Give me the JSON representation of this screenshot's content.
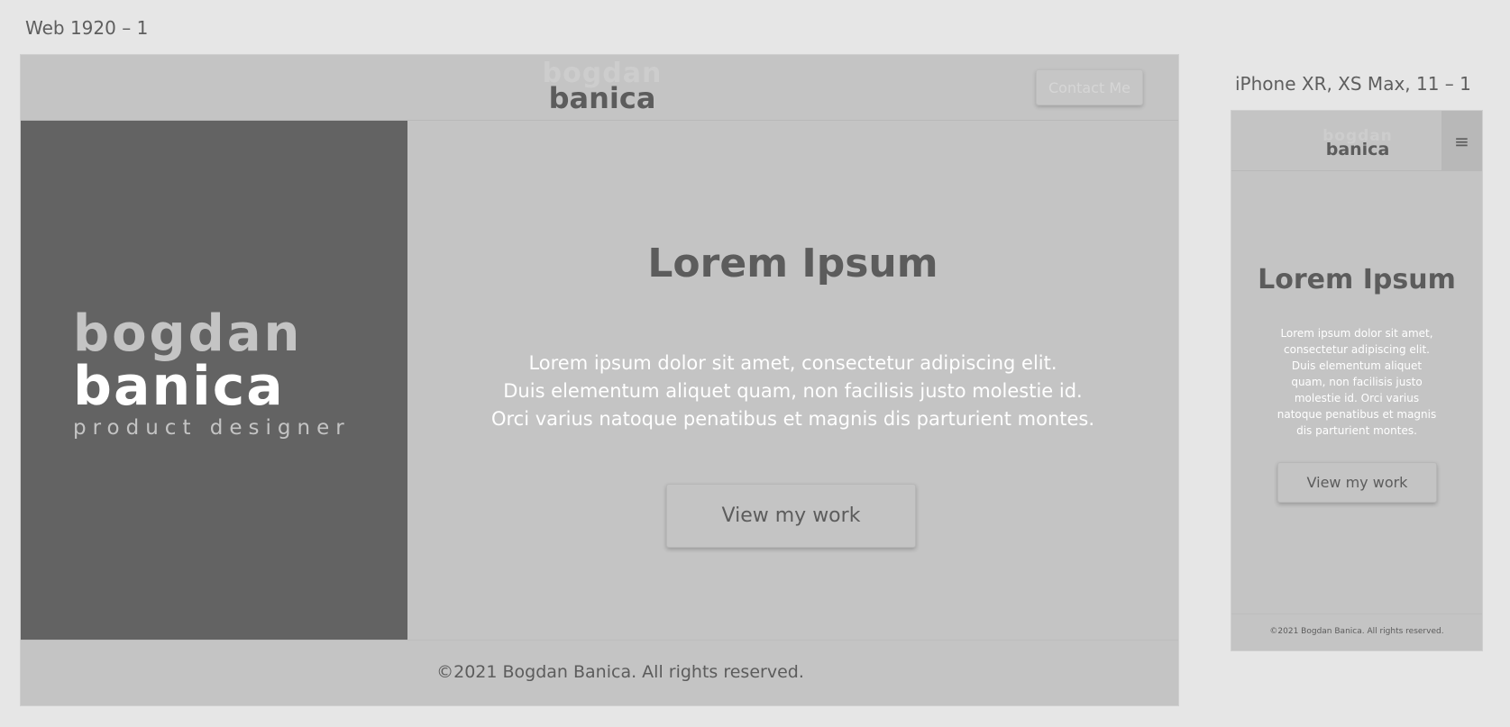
{
  "artboards": {
    "web_label": "Web 1920 – 1",
    "phone_label": "iPhone XR, XS Max, 11 – 1"
  },
  "logo": {
    "line1": "bogdan",
    "line2": "banica"
  },
  "brand": {
    "line1": "bogdan",
    "line2": "banica",
    "tagline": "product designer"
  },
  "header": {
    "contact_label": "Contact Me",
    "menu_icon": "hamburger-icon"
  },
  "hero": {
    "title": "Lorem Ipsum",
    "desktop_lines": [
      "Lorem ipsum dolor sit amet, consectetur adipiscing elit.",
      "Duis elementum aliquet quam, non facilisis justo molestie id.",
      "Orci varius natoque penatibus et magnis dis parturient montes."
    ],
    "mobile_lines": [
      "Lorem ipsum dolor sit amet,",
      "consectetur adipiscing elit.",
      "Duis elementum aliquet",
      "quam, non facilisis justo",
      "molestie id. Orci varius",
      "natoque penatibus et magnis",
      "dis parturient montes."
    ],
    "cta_label": "View my work"
  },
  "footer": {
    "copyright": "©2021 Bogdan Banica. All rights reserved."
  },
  "colors": {
    "canvas": "#e6e6e6",
    "surface": "#c4c4c4",
    "panel": "#636363",
    "text_dark": "#5c5c5c",
    "text_light": "#ffffff"
  }
}
